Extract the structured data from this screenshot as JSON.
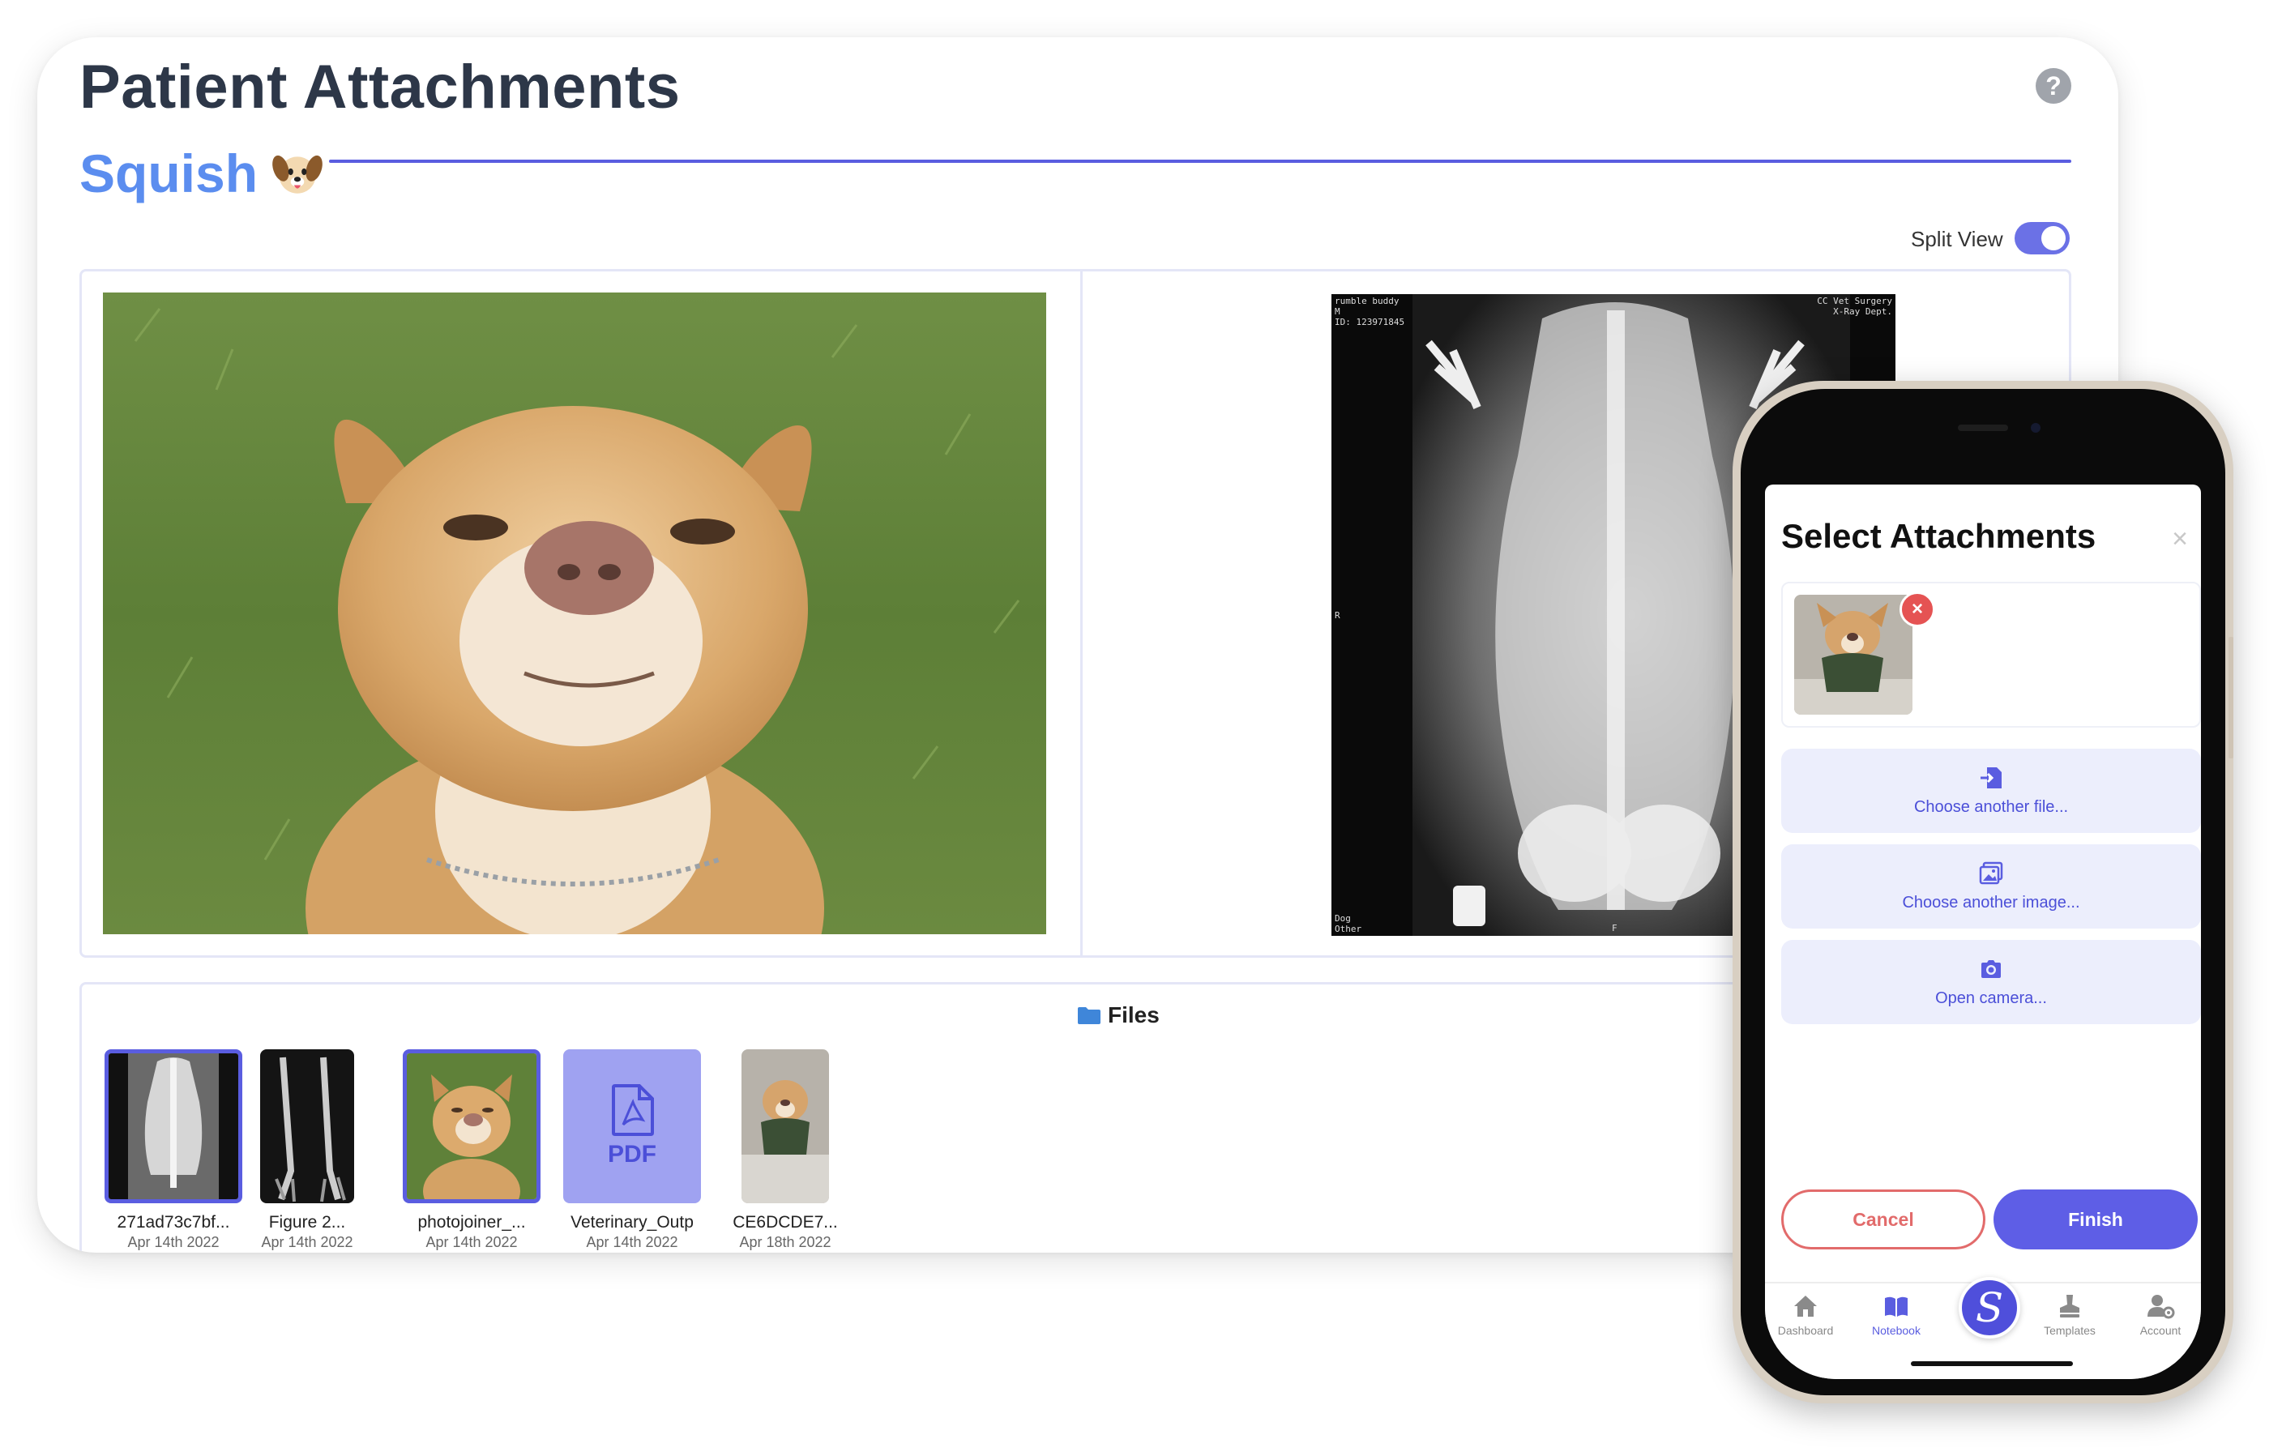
{
  "header": {
    "title": "Patient Attachments",
    "patient_name": "Squish",
    "help_symbol": "?"
  },
  "split_view": {
    "label": "Split View",
    "enabled": true
  },
  "xray": {
    "top_left": "rumble buddy\nM\nID: 123971845",
    "top_right": "CC Vet Surgery\nX-Ray Dept.",
    "marker_r": "R",
    "marker_f": "F",
    "bottom_left": "Dog\nOther"
  },
  "files": {
    "title": "Files",
    "items": [
      {
        "name": "271ad73c7bf...",
        "date": "Apr 14th 2022",
        "selected": true,
        "kind": "xray"
      },
      {
        "name": "Figure 2...",
        "date": "Apr 14th 2022",
        "selected": false,
        "kind": "xray-legs"
      },
      {
        "name": "photojoiner_...",
        "date": "Apr 14th 2022",
        "selected": true,
        "kind": "photo"
      },
      {
        "name": "Veterinary_Outp",
        "date": "Apr 14th 2022",
        "selected": false,
        "kind": "pdf",
        "badge": "PDF"
      },
      {
        "name": "CE6DCDE7...",
        "date": "Apr 18th 2022",
        "selected": false,
        "kind": "photo-jacket"
      }
    ]
  },
  "phone": {
    "sheet_title": "Select Attachments",
    "close_symbol": "×",
    "remove_symbol": "×",
    "actions": [
      {
        "label": "Choose another file...",
        "icon": "file-import-icon"
      },
      {
        "label": "Choose another image...",
        "icon": "images-icon"
      },
      {
        "label": "Open camera...",
        "icon": "camera-icon"
      }
    ],
    "cancel_label": "Cancel",
    "finish_label": "Finish",
    "tabs": [
      {
        "label": "Dashboard",
        "icon": "home-icon",
        "active": false
      },
      {
        "label": "Notebook",
        "icon": "book-icon",
        "active": true
      },
      {
        "label": "Templates",
        "icon": "stamp-icon",
        "active": false
      },
      {
        "label": "Account",
        "icon": "user-cog-icon",
        "active": false
      }
    ],
    "center_logo": "S"
  },
  "colors": {
    "accent": "#5a5de0",
    "patient_name": "#5b8def",
    "cancel": "#e26b6b",
    "finish": "#5e5ee6"
  }
}
